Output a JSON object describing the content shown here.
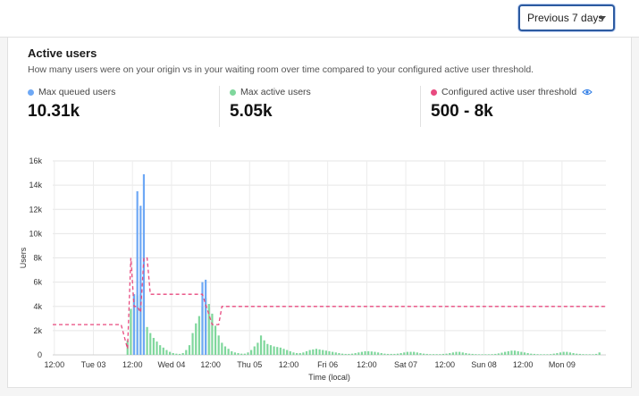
{
  "toolbar": {
    "range_label": "Previous 7 days"
  },
  "card": {
    "title": "Active users",
    "subtitle": "How many users were on your origin vs in your waiting room over time compared to your configured active user threshold."
  },
  "stats": [
    {
      "label": "Max queued users",
      "value": "10.31k",
      "color": "#6ea8f5"
    },
    {
      "label": "Max active users",
      "value": "5.05k",
      "color": "#7fd79c"
    },
    {
      "label": "Configured active user threshold",
      "value": "500 - 8k",
      "color": "#e84a7f"
    }
  ],
  "chart_data": {
    "type": "bar",
    "xlabel": "Time (local)",
    "ylabel": "Users",
    "ylim": [
      0,
      16000
    ],
    "y_ticks": [
      "0",
      "2k",
      "4k",
      "6k",
      "8k",
      "10k",
      "12k",
      "14k",
      "16k"
    ],
    "x_ticks": [
      "12:00",
      "Tue 03",
      "12:00",
      "Wed 04",
      "12:00",
      "Thu 05",
      "12:00",
      "Fri 06",
      "12:00",
      "Sat 07",
      "12:00",
      "Sun 08",
      "12:00",
      "Mon 09"
    ],
    "x_range_hours": [
      0,
      170
    ],
    "series": [
      {
        "name": "Max queued users",
        "color": "#6ea8f5",
        "points": [
          [
            25,
            5000
          ],
          [
            26,
            13500
          ],
          [
            27,
            12300
          ],
          [
            28,
            14900
          ],
          [
            46,
            6000
          ],
          [
            47,
            6200
          ]
        ]
      },
      {
        "name": "Max active users",
        "color": "#7fd79c",
        "points": [
          [
            23,
            1200
          ],
          [
            24,
            3800
          ],
          [
            25,
            5000
          ],
          [
            26,
            4900
          ],
          [
            27,
            5000
          ],
          [
            28,
            4800
          ],
          [
            29,
            2300
          ],
          [
            30,
            1800
          ],
          [
            31,
            1400
          ],
          [
            32,
            1100
          ],
          [
            33,
            800
          ],
          [
            34,
            600
          ],
          [
            35,
            400
          ],
          [
            36,
            250
          ],
          [
            37,
            150
          ],
          [
            38,
            100
          ],
          [
            39,
            80
          ],
          [
            40,
            150
          ],
          [
            41,
            400
          ],
          [
            42,
            800
          ],
          [
            43,
            1800
          ],
          [
            44,
            2600
          ],
          [
            45,
            3200
          ],
          [
            46,
            4000
          ],
          [
            47,
            4700
          ],
          [
            48,
            4200
          ],
          [
            49,
            3400
          ],
          [
            50,
            2400
          ],
          [
            51,
            1600
          ],
          [
            52,
            1000
          ],
          [
            53,
            700
          ],
          [
            54,
            500
          ],
          [
            55,
            300
          ],
          [
            56,
            200
          ],
          [
            57,
            150
          ],
          [
            58,
            100
          ],
          [
            59,
            100
          ],
          [
            60,
            200
          ],
          [
            61,
            400
          ],
          [
            62,
            700
          ],
          [
            63,
            1000
          ],
          [
            64,
            1600
          ],
          [
            65,
            1200
          ],
          [
            66,
            900
          ],
          [
            67,
            800
          ],
          [
            68,
            700
          ],
          [
            69,
            650
          ],
          [
            70,
            600
          ],
          [
            71,
            500
          ],
          [
            72,
            400
          ],
          [
            73,
            300
          ],
          [
            74,
            200
          ],
          [
            75,
            150
          ],
          [
            76,
            150
          ],
          [
            77,
            200
          ],
          [
            78,
            300
          ],
          [
            79,
            400
          ],
          [
            80,
            450
          ],
          [
            81,
            500
          ],
          [
            82,
            450
          ],
          [
            83,
            400
          ],
          [
            84,
            350
          ],
          [
            85,
            300
          ],
          [
            86,
            250
          ],
          [
            87,
            200
          ],
          [
            88,
            150
          ],
          [
            89,
            100
          ],
          [
            90,
            80
          ],
          [
            91,
            80
          ],
          [
            92,
            100
          ],
          [
            93,
            150
          ],
          [
            94,
            200
          ],
          [
            95,
            250
          ],
          [
            96,
            300
          ],
          [
            97,
            300
          ],
          [
            98,
            280
          ],
          [
            99,
            250
          ],
          [
            100,
            200
          ],
          [
            101,
            150
          ],
          [
            102,
            100
          ],
          [
            103,
            80
          ],
          [
            104,
            80
          ],
          [
            105,
            80
          ],
          [
            106,
            100
          ],
          [
            107,
            150
          ],
          [
            108,
            200
          ],
          [
            109,
            250
          ],
          [
            110,
            250
          ],
          [
            111,
            250
          ],
          [
            112,
            200
          ],
          [
            113,
            150
          ],
          [
            114,
            100
          ],
          [
            115,
            80
          ],
          [
            116,
            60
          ],
          [
            117,
            60
          ],
          [
            118,
            60
          ],
          [
            119,
            60
          ],
          [
            120,
            80
          ],
          [
            121,
            100
          ],
          [
            122,
            150
          ],
          [
            123,
            200
          ],
          [
            124,
            250
          ],
          [
            125,
            250
          ],
          [
            126,
            200
          ],
          [
            127,
            150
          ],
          [
            128,
            100
          ],
          [
            129,
            80
          ],
          [
            130,
            60
          ],
          [
            131,
            50
          ],
          [
            132,
            50
          ],
          [
            133,
            50
          ],
          [
            134,
            50
          ],
          [
            135,
            60
          ],
          [
            136,
            80
          ],
          [
            137,
            120
          ],
          [
            138,
            180
          ],
          [
            139,
            250
          ],
          [
            140,
            300
          ],
          [
            141,
            350
          ],
          [
            142,
            350
          ],
          [
            143,
            300
          ],
          [
            144,
            250
          ],
          [
            145,
            200
          ],
          [
            146,
            150
          ],
          [
            147,
            100
          ],
          [
            148,
            80
          ],
          [
            149,
            60
          ],
          [
            150,
            50
          ],
          [
            151,
            50
          ],
          [
            152,
            50
          ],
          [
            153,
            60
          ],
          [
            154,
            100
          ],
          [
            155,
            150
          ],
          [
            156,
            200
          ],
          [
            157,
            250
          ],
          [
            158,
            250
          ],
          [
            159,
            200
          ],
          [
            160,
            150
          ],
          [
            161,
            100
          ],
          [
            162,
            80
          ],
          [
            163,
            60
          ],
          [
            164,
            50
          ],
          [
            165,
            50
          ],
          [
            166,
            50
          ],
          [
            167,
            80
          ],
          [
            168,
            200
          ]
        ]
      },
      {
        "name": "Configured active user threshold",
        "color": "#e84a7f",
        "style": "dashed",
        "points": [
          [
            0,
            2500
          ],
          [
            21,
            2500
          ],
          [
            23,
            500
          ],
          [
            24,
            8000
          ],
          [
            25,
            4000
          ],
          [
            26,
            4000
          ],
          [
            27,
            3500
          ],
          [
            28,
            8000
          ],
          [
            29,
            8000
          ],
          [
            30,
            5000
          ],
          [
            45,
            5000
          ],
          [
            46,
            5000
          ],
          [
            49,
            2500
          ],
          [
            51,
            2500
          ],
          [
            52,
            4000
          ],
          [
            170,
            4000
          ]
        ]
      }
    ]
  }
}
